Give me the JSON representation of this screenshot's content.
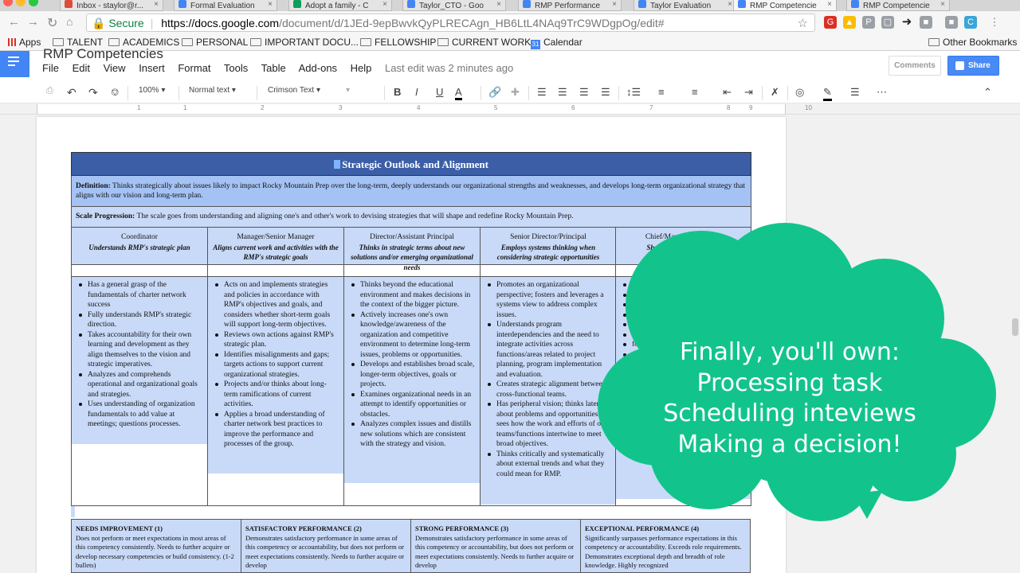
{
  "tabs": [
    {
      "label": "Inbox - staylor@r...",
      "color": "#dd4b39"
    },
    {
      "label": "Formal Evaluation",
      "color": "#4285f4"
    },
    {
      "label": "Adopt a family - C",
      "color": "#0f9d58"
    },
    {
      "label": "Taylor_CTO - Goo",
      "color": "#4285f4"
    },
    {
      "label": "RMP Performance",
      "color": "#4285f4"
    },
    {
      "label": "Taylor Evaluation",
      "color": "#4285f4"
    },
    {
      "label": "RMP Competencie",
      "color": "#4285f4"
    },
    {
      "label": "RMP Competencie",
      "color": "#4285f4"
    }
  ],
  "address_bar": {
    "secure_label": "Secure",
    "url_domain": "https://docs.google.com",
    "url_path": "/document/d/1JEd-9epBwvkQyPLRECAgn_HB6LtL4NAq9TrC9WDgpOg/edit#"
  },
  "bookmarks": {
    "apps": "Apps",
    "items": [
      "TALENT",
      "ACADEMICS",
      "PERSONAL",
      "IMPORTANT DOCU...",
      "FELLOWSHIP",
      "CURRENT WORK",
      "Calendar"
    ],
    "other": "Other Bookmarks"
  },
  "docs": {
    "title": "RMP Competencies",
    "menus": [
      "File",
      "Edit",
      "View",
      "Insert",
      "Format",
      "Tools",
      "Table",
      "Add-ons",
      "Help"
    ],
    "last_edit": "Last edit was 2 minutes ago",
    "comments": "Comments",
    "share": "Share"
  },
  "toolbar": {
    "zoom": "100%",
    "style": "Normal text",
    "font": "Crimson Text"
  },
  "ruler_numbers": [
    "1",
    "1",
    "2",
    "3",
    "4",
    "5",
    "6",
    "7",
    "8",
    "9",
    "10"
  ],
  "competency": {
    "title": "Strategic Outlook and Alignment",
    "definition_label": "Definition:",
    "definition": "Thinks strategically about issues likely to impact Rocky Mountain Prep over the long-term, deeply understands our organizational strengths and weaknesses, and develops long-term organizational strategy that aligns with our vision and long-term plan.",
    "scale_label": "Scale Progression:",
    "scale": "The scale goes from understanding and aligning one's and other's work to devising strategies that will shape and redefine Rocky Mountain Prep.",
    "columns": [
      {
        "role": "Coordinator",
        "desc": "Understands RMP's strategic plan",
        "bullets": [
          "Has a general grasp of the fundamentals of charter network success",
          "Fully understands RMP's strategic direction.",
          "Takes accountability for their own learning and development as they align themselves to the vision and strategic imperatives.",
          "Analyzes and comprehends operational and organizational goals and strategies.",
          "Uses understanding of organization fundamentals to add value at meetings; questions processes."
        ]
      },
      {
        "role": "Manager/Senior Manager",
        "desc": "Aligns current work and activities with the RMP's strategic goals",
        "bullets": [
          "Acts on and implements strategies and policies in accordance with RMP's objectives and goals, and considers whether short-term goals will support long-term objectives.",
          "Reviews own actions against RMP's strategic plan.",
          "Identifies misalignments and gaps; targets actions to support current organizational strategies.",
          "Projects and/or thinks about long-term ramifications of current activities.",
          "Applies a broad understanding of charter network best practices to improve the performance and processes of the group."
        ]
      },
      {
        "role": "Director/Assistant Principal",
        "desc": "Thinks in strategic terms about new solutions and/or emerging organizational needs",
        "bullets": [
          "Thinks beyond the educational environment and makes decisions in the context of the bigger picture.",
          "Actively increases one's own knowledge/awareness of the organization and competitive environment to determine long-term issues, problems or opportunities.",
          "Develops and establishes broad scale, longer-term objectives, goals or projects.",
          "Examines organizational needs in an attempt to identify opportunities or obstacles.",
          "Analyzes complex issues and distills new solutions which are consistent with the strategy and vision."
        ]
      },
      {
        "role": "Senior Director/Principal",
        "desc": "Employs systems thinking when considering strategic opportunities",
        "bullets": [
          "Promotes an organizational perspective; fosters and leverages a systems view to address complex issues.",
          "Understands program interdependencies and the need to integrate activities across functions/areas related to project planning, program implementation and evaluation.",
          "Creates strategic alignment between cross-functional teams.",
          "Has peripheral vision; thinks laterally about problems and opportunities; sees how the work and efforts of other teams/functions intertwine to meet broad objectives.",
          "Thinks critically and systematically about external trends and what they could mean for RMP."
        ]
      },
      {
        "role": "Chief/Managing Director",
        "desc": "Shapes or redefines what",
        "bullets": [
          "Shapes or",
          "redesi",
          "gover",
          "RMP",
          "obje",
          "Defi",
          "for t",
          "com",
          "fun"
        ]
      }
    ],
    "performance": [
      {
        "title": "NEEDS IMPROVEMENT (1)",
        "text": "Does not perform or meet expectations in most areas of this competency consistently. Needs to further acquire or develop necessary competencies or build consistency. (1-2 bullets)"
      },
      {
        "title": "SATISFACTORY PERFORMANCE (2)",
        "text": "Demonstrates satisfactory performance in some areas of this competency or accountability, but does not perform or meet expectations consistently. Needs to further acquire or develop"
      },
      {
        "title": "STRONG PERFORMANCE (3)",
        "text": "Demonstrates satisfactory performance in some areas of this competency or accountability, but does not perform or meet expectations consistently. Needs to further acquire or develop"
      },
      {
        "title": "EXCEPTIONAL PERFORMANCE (4)",
        "text": "Significantly surpasses performance expectations in this competency or accountability. Exceeds role requirements. Demonstrates exceptional depth and breadth of role knowledge. Highly recognized"
      }
    ]
  },
  "callout": {
    "lines": [
      "Finally, you'll own:",
      "Processing task",
      "Scheduling inteviews",
      "Making a decision!"
    ],
    "color": "#12c48b"
  }
}
